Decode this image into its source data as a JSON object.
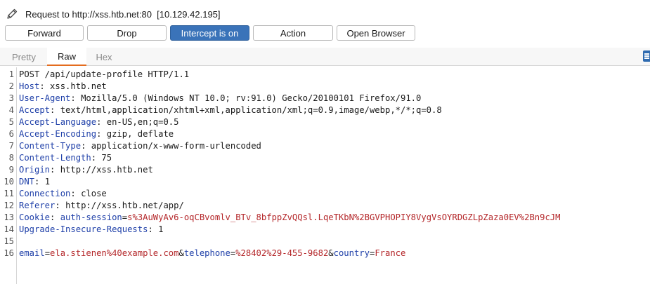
{
  "request_title": "Request to http://xss.htb.net:80  [10.129.42.195]",
  "buttons": {
    "forward": "Forward",
    "drop": "Drop",
    "intercept": "Intercept is on",
    "action": "Action",
    "open_browser": "Open Browser"
  },
  "tabs": {
    "pretty": "Pretty",
    "raw": "Raw",
    "hex": "Hex"
  },
  "colors": {
    "active_button": "#3a73b9",
    "tab_underline": "#e46c1e",
    "header_name": "#1e3fa8",
    "param_value": "#b4272a"
  },
  "request": {
    "line_numbers": [
      "1",
      "2",
      "3",
      "4",
      "5",
      "6",
      "7",
      "8",
      "9",
      "10",
      "11",
      "12",
      "13",
      "14",
      "15",
      "16"
    ],
    "request_line": "POST /api/update-profile HTTP/1.1",
    "headers": [
      {
        "name": "Host",
        "value": "xss.htb.net"
      },
      {
        "name": "User-Agent",
        "value": "Mozilla/5.0 (Windows NT 10.0; rv:91.0) Gecko/20100101 Firefox/91.0"
      },
      {
        "name": "Accept",
        "value": "text/html,application/xhtml+xml,application/xml;q=0.9,image/webp,*/*;q=0.8"
      },
      {
        "name": "Accept-Language",
        "value": "en-US,en;q=0.5"
      },
      {
        "name": "Accept-Encoding",
        "value": "gzip, deflate"
      },
      {
        "name": "Content-Type",
        "value": "application/x-www-form-urlencoded"
      },
      {
        "name": "Content-Length",
        "value": "75"
      },
      {
        "name": "Origin",
        "value": "http://xss.htb.net"
      },
      {
        "name": "DNT",
        "value": "1"
      },
      {
        "name": "Connection",
        "value": "close"
      },
      {
        "name": "Referer",
        "value": "http://xss.htb.net/app/"
      }
    ],
    "cookie": {
      "name": "Cookie",
      "param": "auth-session",
      "value": "s%3AuWyAv6-oqCBvomlv_BTv_8bfppZvQQsl.LqeTKbN%2BGVPHOPIY8VygVsOYRDGZLpZaza0EV%2Bn9cJM"
    },
    "upgrade_header": {
      "name": "Upgrade-Insecure-Requests",
      "value": "1"
    },
    "body": [
      {
        "param": "email",
        "value": "ela.stienen%40example.com"
      },
      {
        "param": "telephone",
        "value": "%28402%29-455-9682"
      },
      {
        "param": "country",
        "value": "France"
      }
    ]
  }
}
